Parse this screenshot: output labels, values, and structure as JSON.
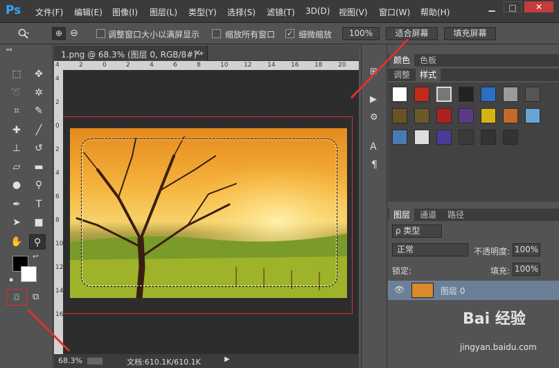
{
  "app": {
    "logo": "Ps"
  },
  "menu": [
    "文件(F)",
    "编辑(E)",
    "图像(I)",
    "图层(L)",
    "类型(Y)",
    "选择(S)",
    "滤镜(T)",
    "3D(D)",
    "视图(V)",
    "窗口(W)",
    "帮助(H)"
  ],
  "window_buttons": [
    "▁",
    "□",
    "✕"
  ],
  "options": {
    "resize_label": "调整窗口大小以满屏显示",
    "zoom_all_label": "缩放所有窗口",
    "scrubby_label": "细微缩放",
    "zoom_value": "100%",
    "fit_screen": "适合屏幕",
    "fill_screen": "填充屏幕",
    "resize_checked": false,
    "zoom_all_checked": false,
    "scrubby_checked": true
  },
  "document": {
    "tab_title": "1.png @ 68.3% (图层 0, RGB/8#) *",
    "close": "×"
  },
  "ruler_top": [
    "4",
    "2",
    "0",
    "2",
    "4",
    "6",
    "8",
    "10",
    "12",
    "14",
    "16",
    "18",
    "20"
  ],
  "ruler_left": [
    "4",
    "2",
    "0",
    "2",
    "4",
    "6",
    "8",
    "10",
    "12",
    "14",
    "16"
  ],
  "status": {
    "zoom": "68.3%",
    "doc_info": "文档:610.1K/610.1K"
  },
  "swatch_panel": {
    "tabs": [
      "颜色",
      "色板"
    ]
  },
  "styles_panel": {
    "tabs": [
      "调整",
      "样式"
    ]
  },
  "layers_panel": {
    "tabs": [
      "图层",
      "通道",
      "路径"
    ],
    "kind_label": "ρ 类型",
    "blend_mode": "正常",
    "opacity_label": "不透明度:",
    "opacity_value": "100%",
    "lock_label": "锁定:",
    "fill_label": "填充:",
    "fill_value": "100%",
    "layer_name": "图层 0"
  },
  "watermark": {
    "brand": "Bai 经验",
    "url": "jingyan.baidu.com"
  },
  "colors": {
    "accent": "#31a8ff",
    "annotation": "#e03030",
    "selected_layer": "#6b7f99"
  }
}
